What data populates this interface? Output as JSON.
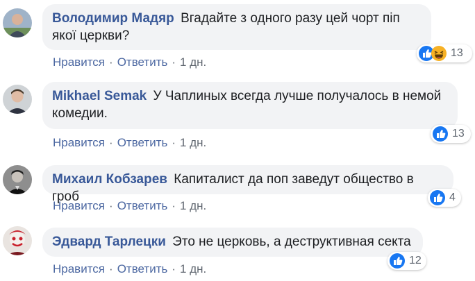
{
  "comments": [
    {
      "author": "Володимир Мадяр",
      "text": "Вгадайте з одного разу цей чорт піп якої церкви?",
      "actions": {
        "like": "Нравится",
        "reply": "Ответить",
        "time": "1 дн."
      },
      "reactions": {
        "count": "13",
        "icons": [
          "like-icon",
          "haha-icon"
        ]
      }
    },
    {
      "author": "Mikhael Semak",
      "text": "У Чаплиных всегда лучше получалось в немой комедии.",
      "actions": {
        "like": "Нравится",
        "reply": "Ответить",
        "time": "1 дн."
      },
      "reactions": {
        "count": "13",
        "icons": [
          "like-icon"
        ]
      }
    },
    {
      "author": "Михаил Кобзарев",
      "text": "Капиталист да поп заведут общество в гроб",
      "actions": {
        "like": "Нравится",
        "reply": "Ответить",
        "time": "1 дн."
      },
      "reactions": {
        "count": "4",
        "icons": [
          "like-icon"
        ]
      }
    },
    {
      "author": "Эдвард Тарлецки",
      "text": "Это не церковь, а деструктивная секта",
      "actions": {
        "like": "Нравится",
        "reply": "Ответить",
        "time": "1 дн."
      },
      "reactions": {
        "count": "12",
        "icons": [
          "like-icon"
        ]
      }
    }
  ],
  "colors": {
    "author": "#385898",
    "bubble": "#f2f3f5",
    "link": "#4b67a1",
    "like": "#1877f2",
    "haha": "#f7b125"
  },
  "separator": "·"
}
